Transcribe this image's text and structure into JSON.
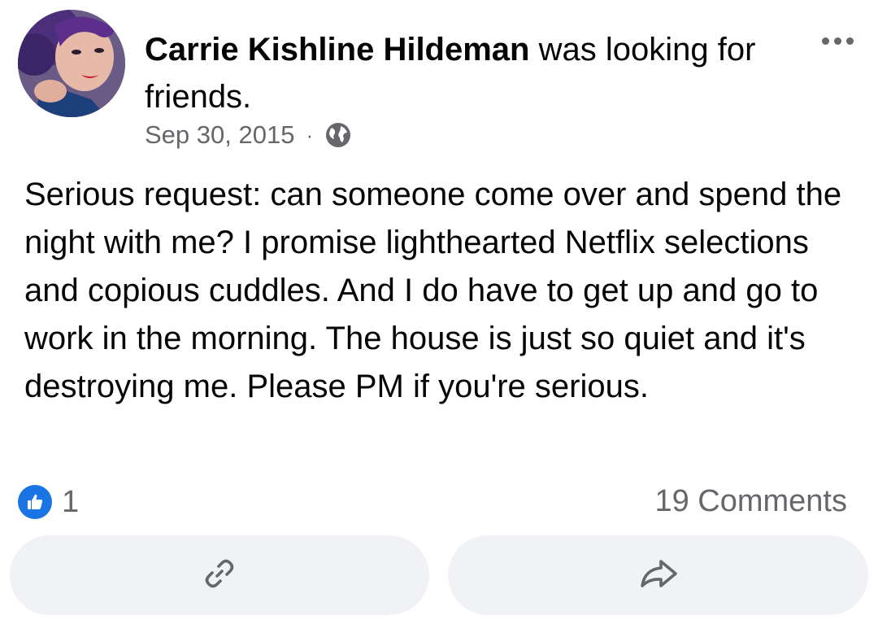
{
  "post": {
    "author": "Carrie Kishline Hildeman",
    "activity": " was looking for friends.",
    "date": "Sep 30, 2015",
    "separator": "·",
    "audience_icon": "globe-icon",
    "more_icon": "more-options-icon",
    "body": "Serious request: can someone come over and spend the night with me? I promise lighthearted Netflix selections and copious cuddles. And I do have to get up and go to work in the morning. The house is just so quiet and it's destroying me. Please PM if you're serious."
  },
  "engagement": {
    "reaction_icon": "like-icon",
    "reaction_count": "1",
    "comments_label": "19 Comments"
  },
  "actions": {
    "copy_link_icon": "link-icon",
    "share_icon": "share-arrow-icon"
  },
  "colors": {
    "like_blue": "#1b74e4",
    "secondary_text": "#65676b",
    "button_bg": "#f0f2f5"
  }
}
